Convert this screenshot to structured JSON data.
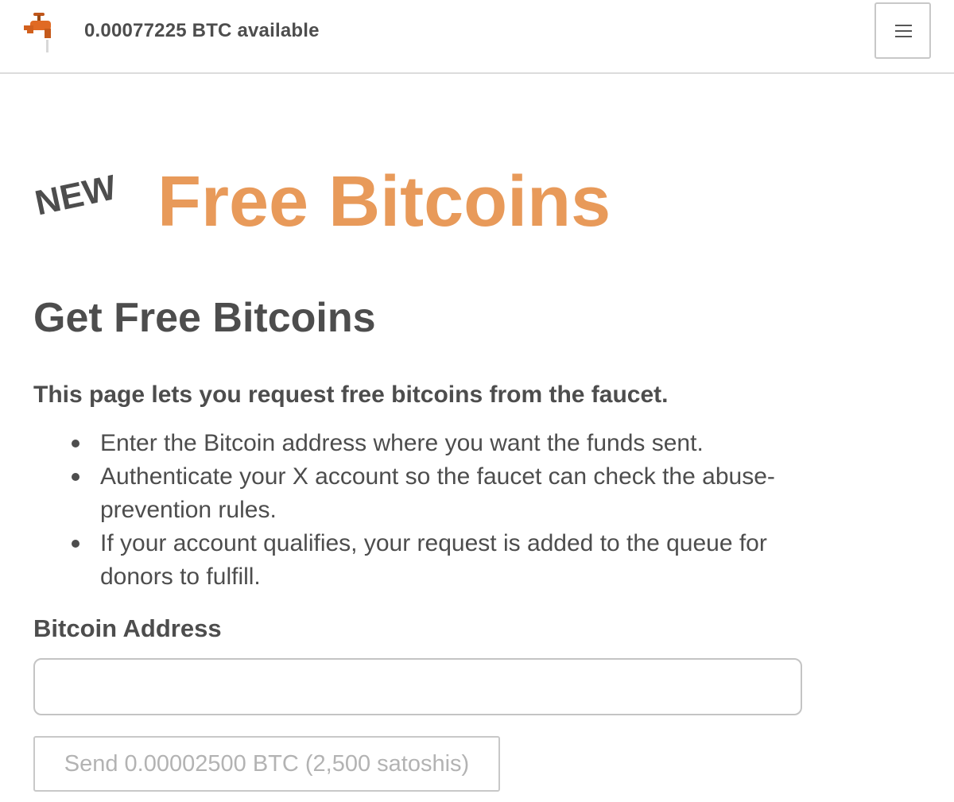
{
  "header": {
    "logo_icon": "faucet-icon",
    "balance_text": "0.00077225 BTC available",
    "menu_icon": "hamburger-menu-icon"
  },
  "hero": {
    "new_tag": "NEW",
    "title": "Free Bitcoins"
  },
  "main": {
    "heading": "Get Free Bitcoins",
    "intro": "This page lets you request free bitcoins from the faucet.",
    "steps": [
      "Enter the Bitcoin address where you want the funds sent.",
      "Authenticate your X account so the faucet can check the abuse-prevention rules.",
      "If your account qualifies, your request is added to the queue for donors to fulfill."
    ],
    "address_label": "Bitcoin Address",
    "address_value": "",
    "send_button_label": "Send 0.00002500 BTC (2,500 satoshis)"
  },
  "colors": {
    "accent": "#e89a5a",
    "text": "#4d4d4d",
    "disabled_text": "#b3b3b3",
    "border": "#c8c8c8"
  }
}
